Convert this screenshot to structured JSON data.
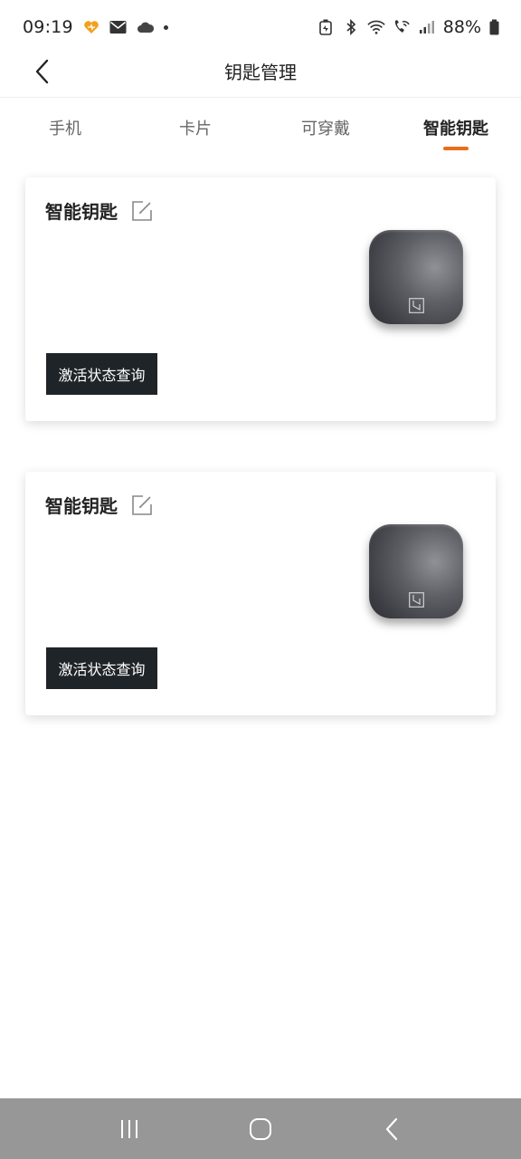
{
  "status_bar": {
    "time": "09:19",
    "battery": "88%",
    "icons": [
      "heart-icon",
      "mail-icon",
      "cloud-icon",
      "dot-icon",
      "battery-saver-icon",
      "bluetooth-icon",
      "wifi-icon",
      "call-wifi-icon",
      "signal-icon",
      "battery-icon"
    ]
  },
  "header": {
    "title": "钥匙管理",
    "back_icon": "chevron-left-icon"
  },
  "tabs": [
    {
      "label": "手机",
      "active": false
    },
    {
      "label": "卡片",
      "active": false
    },
    {
      "label": "可穿戴",
      "active": false
    },
    {
      "label": "智能钥匙",
      "active": true
    }
  ],
  "accent_color": "#ea6d1d",
  "cards": [
    {
      "title": "智能钥匙",
      "button_label": "激活状态查询",
      "edit_icon": "edit-icon"
    },
    {
      "title": "智能钥匙",
      "button_label": "激活状态查询",
      "edit_icon": "edit-icon"
    }
  ],
  "nav_bar": {
    "buttons": [
      "recent-apps-icon",
      "home-icon",
      "back-icon"
    ]
  }
}
